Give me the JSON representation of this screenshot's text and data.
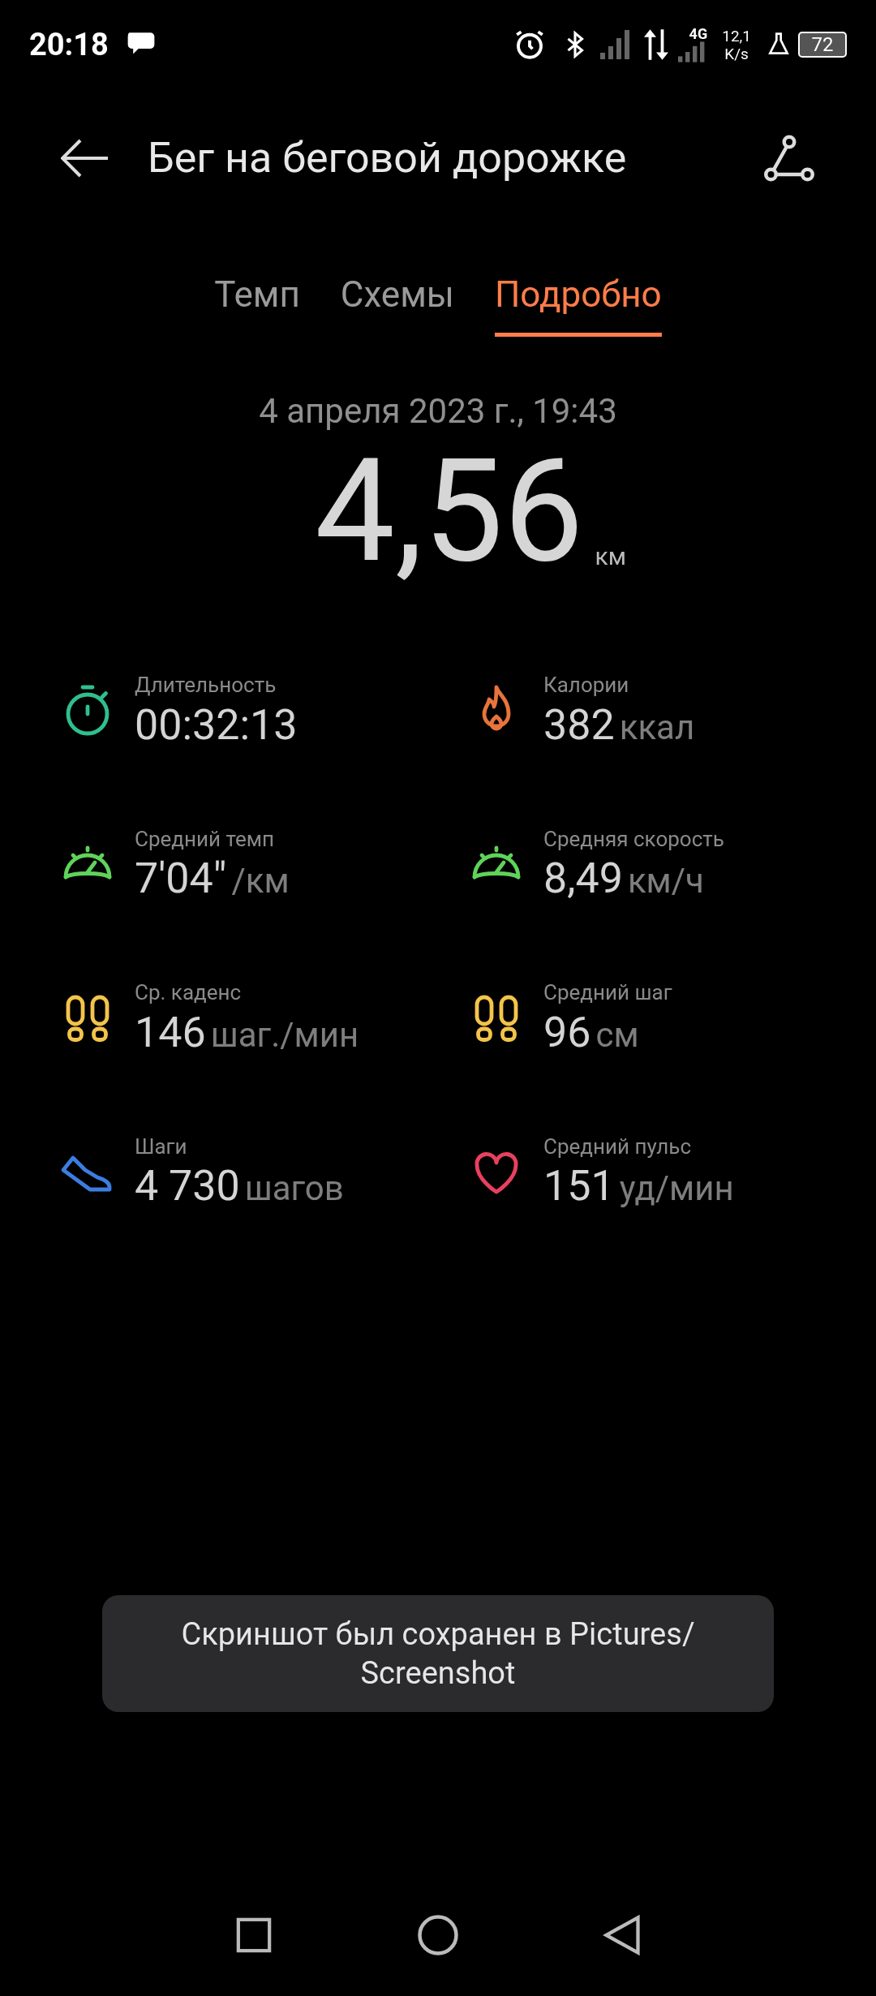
{
  "status_bar": {
    "time": "20:18",
    "network_type": "4G",
    "speed_value": "12,1",
    "speed_unit": "K/s",
    "battery": "72"
  },
  "header": {
    "title": "Бег на беговой дорожке"
  },
  "tabs": [
    {
      "label": "Темп",
      "selected": false
    },
    {
      "label": "Схемы",
      "selected": false
    },
    {
      "label": "Подробно",
      "selected": true
    }
  ],
  "date": "4 апреля 2023 г., 19:43",
  "distance": {
    "value": "4,56",
    "unit": "км"
  },
  "metrics": [
    {
      "kind": "timer",
      "color": "#2fbf8f",
      "label": "Длительность",
      "value": "00:32:13"
    },
    {
      "kind": "flame",
      "color": "#e8743b",
      "label": "Калории",
      "value": "382",
      "unit": "ккал"
    },
    {
      "kind": "gauge",
      "color": "#5fd35a",
      "label": "Средний темп",
      "value": "7'04\"",
      "unit": "/км"
    },
    {
      "kind": "gauge",
      "color": "#5fd35a",
      "label": "Средняя скорость",
      "value": "8,49",
      "unit": "км/ч"
    },
    {
      "kind": "feet",
      "color": "#f3c34b",
      "label": "Ср. каденс",
      "value": "146",
      "unit": "шаг./мин"
    },
    {
      "kind": "feet",
      "color": "#f3c34b",
      "label": "Средний шаг",
      "value": "96",
      "unit": "см"
    },
    {
      "kind": "shoe",
      "color": "#3c7de0",
      "label": "Шаги",
      "value": "4 730",
      "unit": "шагов"
    },
    {
      "kind": "heart",
      "color": "#e8405f",
      "label": "Средний пульс",
      "value": "151",
      "unit": "уд/мин"
    }
  ],
  "toast": {
    "text": "Скриншот был сохранен в  Pictures/ Screenshot"
  }
}
